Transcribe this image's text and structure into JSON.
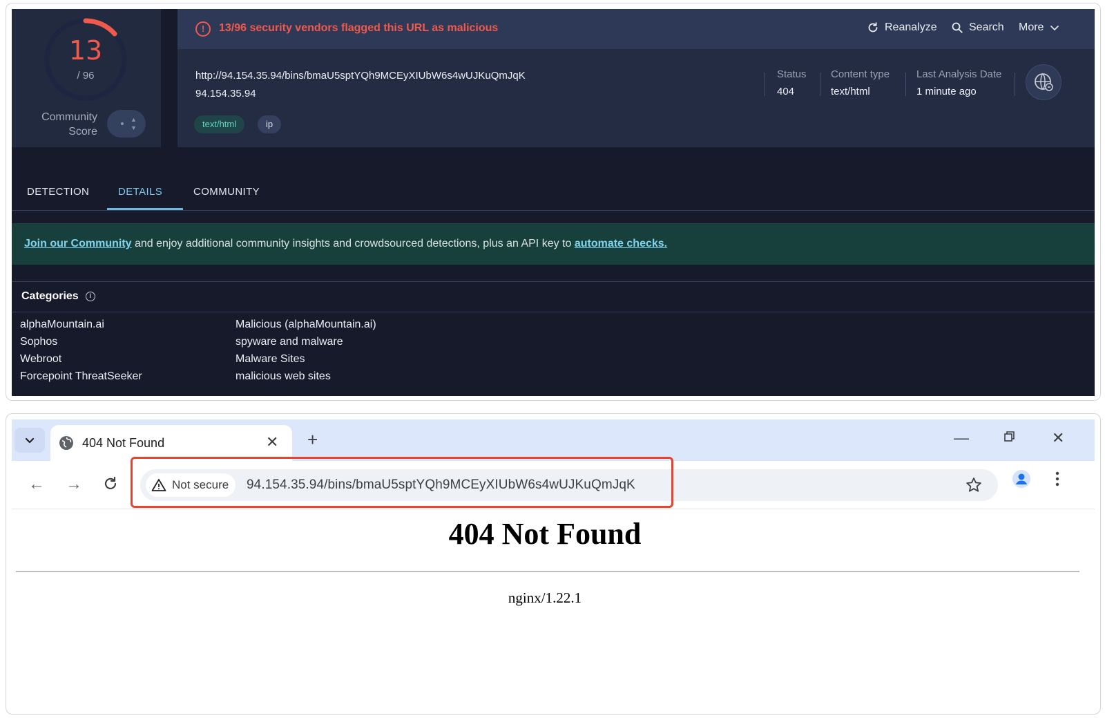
{
  "vt": {
    "score": {
      "value": "13",
      "total": "/ 96",
      "community_label": "Community Score",
      "malicious_fraction": 0.135
    },
    "alert": {
      "text": "13/96 security vendors flagged this URL as malicious",
      "icon": "alert-circle-icon"
    },
    "actions": {
      "reanalyze": "Reanalyze",
      "search": "Search",
      "more": "More"
    },
    "url": "http://94.154.35.94/bins/bmaU5sptYQh9MCEyXIUbW6s4wUJKuQmJqK",
    "host": "94.154.35.94",
    "tags": [
      "text/html",
      "ip"
    ],
    "meta": {
      "status_label": "Status",
      "status_value": "404",
      "ctype_label": "Content type",
      "ctype_value": "text/html",
      "last_label": "Last Analysis Date",
      "last_value": "1 minute ago"
    },
    "tabs": [
      "DETECTION",
      "DETAILS",
      "COMMUNITY"
    ],
    "active_tab": "DETAILS",
    "banner": {
      "link1": "Join our Community",
      "middle": " and enjoy additional community insights and crowdsourced detections, plus an API key to ",
      "link2": "automate checks."
    },
    "categories": {
      "title": "Categories",
      "rows": [
        {
          "vendor": "alphaMountain.ai",
          "category": "Malicious (alphaMountain.ai)"
        },
        {
          "vendor": "Sophos",
          "category": "spyware and malware"
        },
        {
          "vendor": "Webroot",
          "category": "Malware Sites"
        },
        {
          "vendor": "Forcepoint ThreatSeeker",
          "category": "malicious web sites"
        }
      ]
    },
    "colors": {
      "malicious": "#ef5a4c",
      "accent": "#6fb8e0",
      "banner": "#17403d"
    }
  },
  "browser": {
    "tab_title": "404 Not Found",
    "security_chip": "Not secure",
    "address": "94.154.35.94/bins/bmaU5sptYQh9MCEyXIUbW6s4wUJKuQmJqK",
    "page_heading": "404 Not Found",
    "server": "nginx/1.22.1",
    "colors": {
      "highlight": "#e5452f",
      "tabstrip": "#dde7fb"
    }
  }
}
